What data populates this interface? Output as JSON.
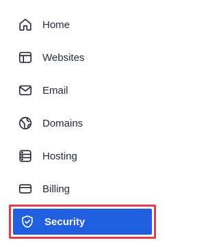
{
  "sidebar": {
    "items": [
      {
        "label": "Home",
        "icon": "home-icon"
      },
      {
        "label": "Websites",
        "icon": "window-icon"
      },
      {
        "label": "Email",
        "icon": "mail-icon"
      },
      {
        "label": "Domains",
        "icon": "globe-icon"
      },
      {
        "label": "Hosting",
        "icon": "server-icon"
      },
      {
        "label": "Billing",
        "icon": "credit-card-icon"
      },
      {
        "label": "Security",
        "icon": "shield-check-icon",
        "active": true
      }
    ]
  },
  "colors": {
    "text": "#1f2937",
    "active_background": "#1f5fe0",
    "active_text": "#ffffff",
    "highlight_border": "#e23a46"
  }
}
